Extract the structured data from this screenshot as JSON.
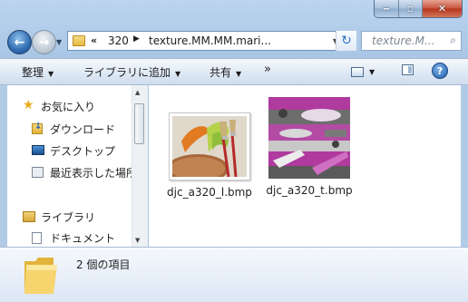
{
  "window": {
    "caption_buttons": {
      "minimize": "minimize-icon",
      "maximize": "maximize-icon",
      "close": "close-icon"
    }
  },
  "nav": {
    "back_icon": "back-arrow-icon",
    "forward_icon": "forward-arrow-icon",
    "address": {
      "chevron": "«",
      "segments": [
        "320",
        "texture.MM.MM.mari..."
      ]
    },
    "search_placeholder": "texture.M..."
  },
  "toolbar": {
    "organize": "整理",
    "add_to_library": "ライブラリに追加",
    "share": "共有",
    "more": "»"
  },
  "sidebar": {
    "items": [
      {
        "label": "お気に入り",
        "icon": "star-icon"
      },
      {
        "label": "ダウンロード",
        "icon": "download-folder-icon"
      },
      {
        "label": "デスクトップ",
        "icon": "desktop-icon"
      },
      {
        "label": "最近表示した場所",
        "icon": "recent-places-icon"
      },
      {
        "label": "ライブラリ",
        "icon": "library-icon"
      },
      {
        "label": "ドキュメント",
        "icon": "document-icon"
      }
    ]
  },
  "files": [
    {
      "name": "djc_a320_l.bmp",
      "icon": "paint-texture-thumbnail"
    },
    {
      "name": "djc_a320_t.bmp",
      "icon": "aircraft-texture-thumbnail"
    }
  ],
  "status": {
    "item_count": "2 個の項目"
  }
}
